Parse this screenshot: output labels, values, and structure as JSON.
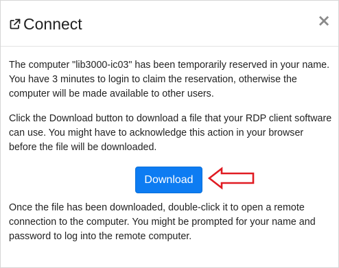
{
  "dialog": {
    "title": "Connect",
    "close_label": "×",
    "title_icon": "external-link-icon",
    "close_icon": "close-icon"
  },
  "body": {
    "paragraph1": "The computer \"lib3000-ic03\" has been temporarily reserved in your name. You have 3 minutes to login to claim the reservation, otherwise the computer will be made available to other users.",
    "paragraph2": "Click the Download button to download a file that your RDP client software can use. You might have to acknowledge this action in your browser before the file will be downloaded.",
    "download_label": "Download",
    "paragraph3": "Once the file has been downloaded, double-click it to open a remote connection to the computer. You might be prompted for your name and password to log into the remote computer."
  },
  "colors": {
    "button": "#0d7cf2",
    "annotation_arrow": "#e01b22"
  }
}
